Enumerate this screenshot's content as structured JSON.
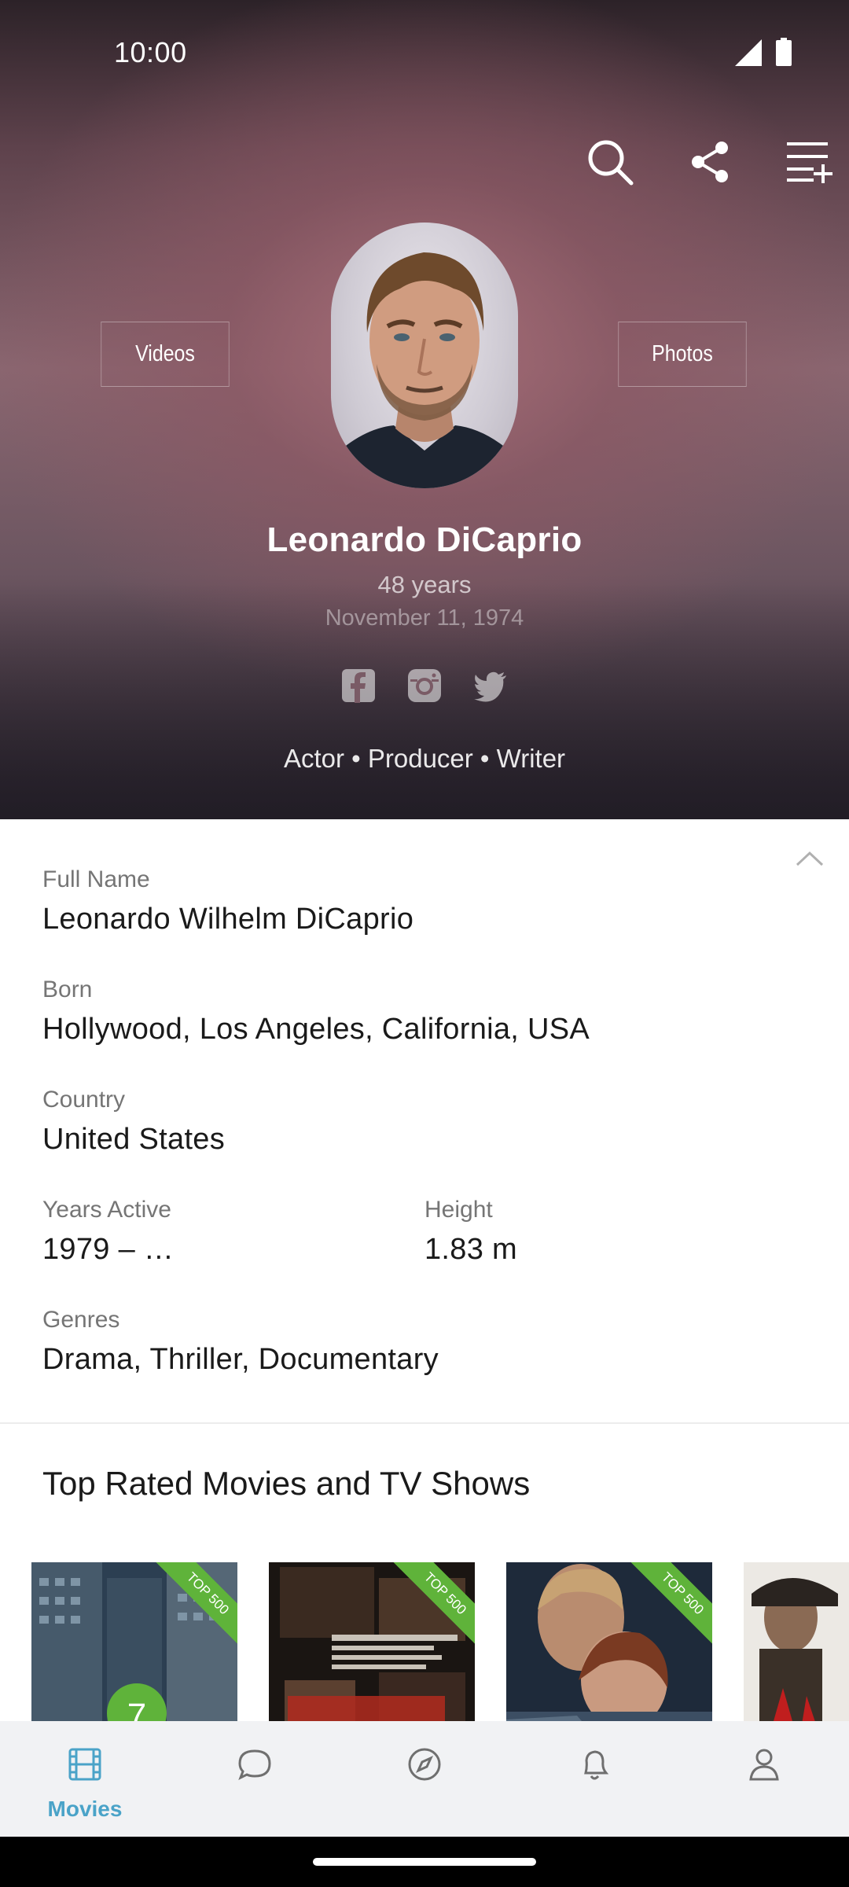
{
  "status_bar": {
    "time": "10:00"
  },
  "header_actions": {
    "search": "search-icon",
    "share": "share-icon",
    "add_to_list": "playlist-add-icon"
  },
  "profile": {
    "videos_label": "Videos",
    "photos_label": "Photos",
    "name": "Leonardo DiCaprio",
    "age": "48 years",
    "birth_date": "November 11, 1974",
    "socials": [
      "facebook-icon",
      "instagram-icon",
      "twitter-icon"
    ],
    "roles": "Actor • Producer • Writer"
  },
  "details": {
    "full_name_label": "Full Name",
    "full_name": "Leonardo Wilhelm DiCaprio",
    "born_label": "Born",
    "born": "Hollywood, Los Angeles, California, USA",
    "country_label": "Country",
    "country": "United States",
    "years_active_label": "Years Active",
    "years_active": "1979 – …",
    "height_label": "Height",
    "height": "1.83 m",
    "genres_label": "Genres",
    "genres": "Drama, Thriller, Documentary"
  },
  "top_rated": {
    "title": "Top Rated Movies and TV Shows",
    "posters": [
      {
        "badge": "TOP 500",
        "rank": "7"
      },
      {
        "badge": "TOP 500"
      },
      {
        "badge": "TOP 500"
      },
      {}
    ]
  },
  "bottom_nav": {
    "items": [
      {
        "label": "Movies",
        "icon": "film-icon",
        "active": true
      },
      {
        "icon": "chat-icon"
      },
      {
        "icon": "compass-icon"
      },
      {
        "icon": "bell-icon"
      },
      {
        "icon": "profile-icon"
      }
    ],
    "active_color": "#4aa3c8",
    "inactive_color": "#7a7a7a"
  },
  "colors": {
    "accent": "#4aa3c8",
    "badge_green": "#5fb33a"
  }
}
